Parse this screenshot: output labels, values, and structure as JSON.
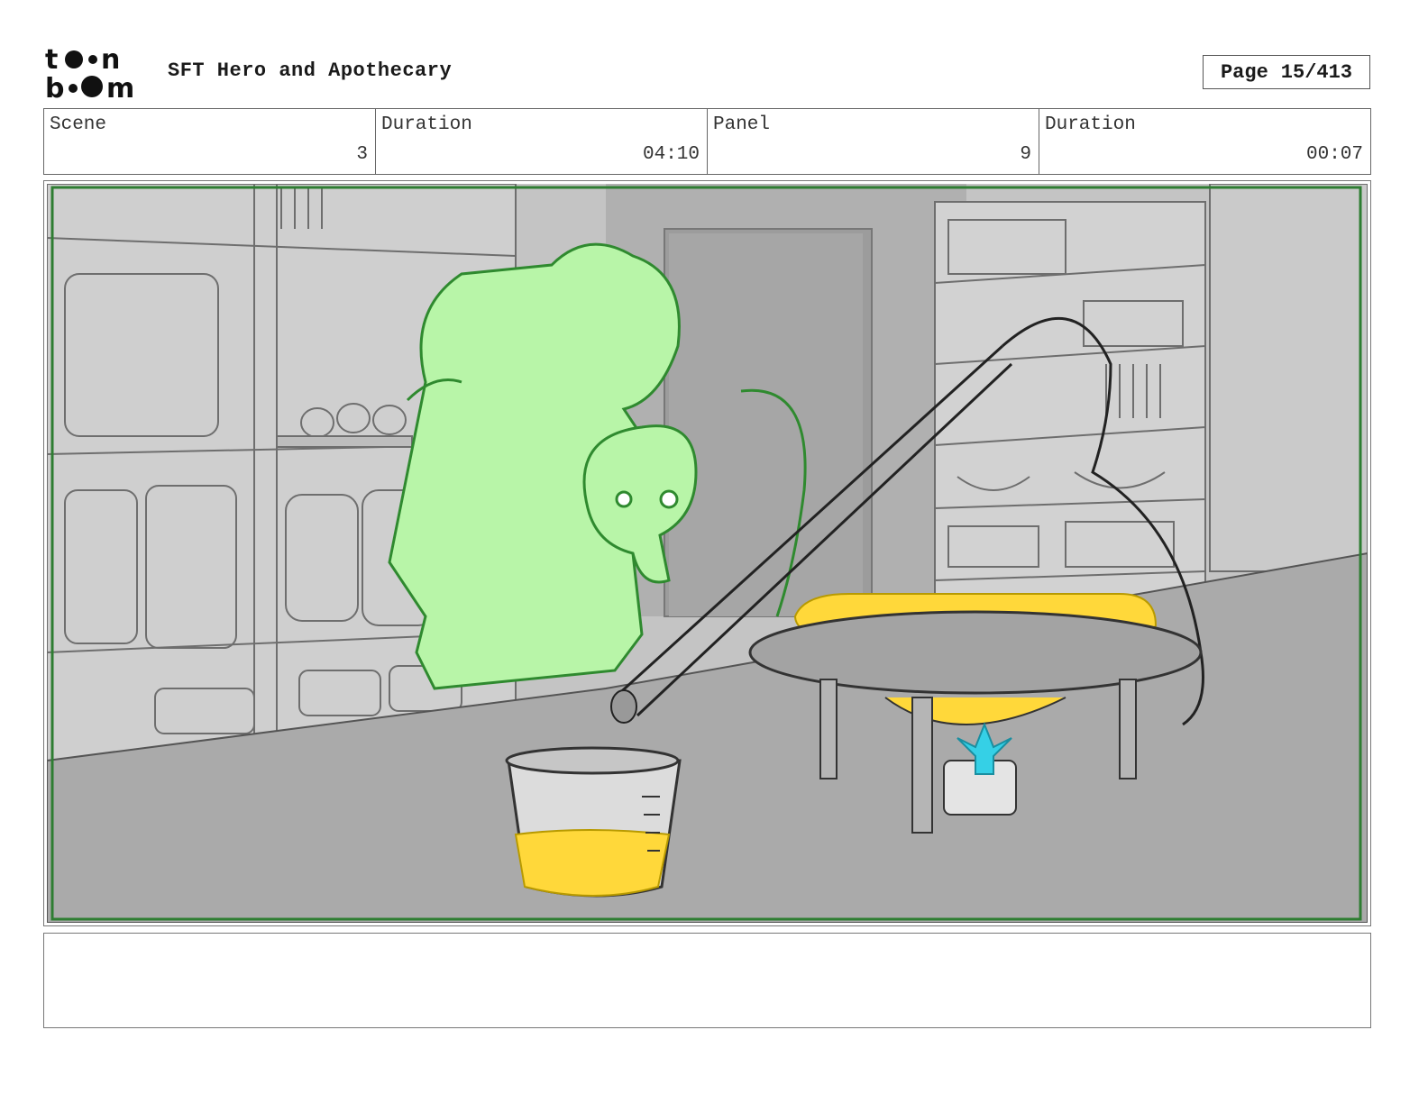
{
  "logo": {
    "line1": "toon",
    "line2": "boom"
  },
  "header": {
    "title": "SFT Hero and Apothecary",
    "page_label": "Page",
    "page_value": "15/413"
  },
  "info": {
    "scene_label": "Scene",
    "scene_value": "3",
    "scene_duration_label": "Duration",
    "scene_duration_value": "04:10",
    "panel_label": "Panel",
    "panel_value": "9",
    "panel_duration_label": "Duration",
    "panel_duration_value": "00:07"
  },
  "notes": {
    "text": ""
  },
  "colors": {
    "safe_frame": "#2e7d32",
    "character_fill": "#b8f5a8",
    "character_line": "#2f8a2f",
    "liquid": "#ffd83a",
    "flame": "#35d0e6",
    "background_gray": "#bdbdbd",
    "table_gray": "#a9a9a9"
  }
}
